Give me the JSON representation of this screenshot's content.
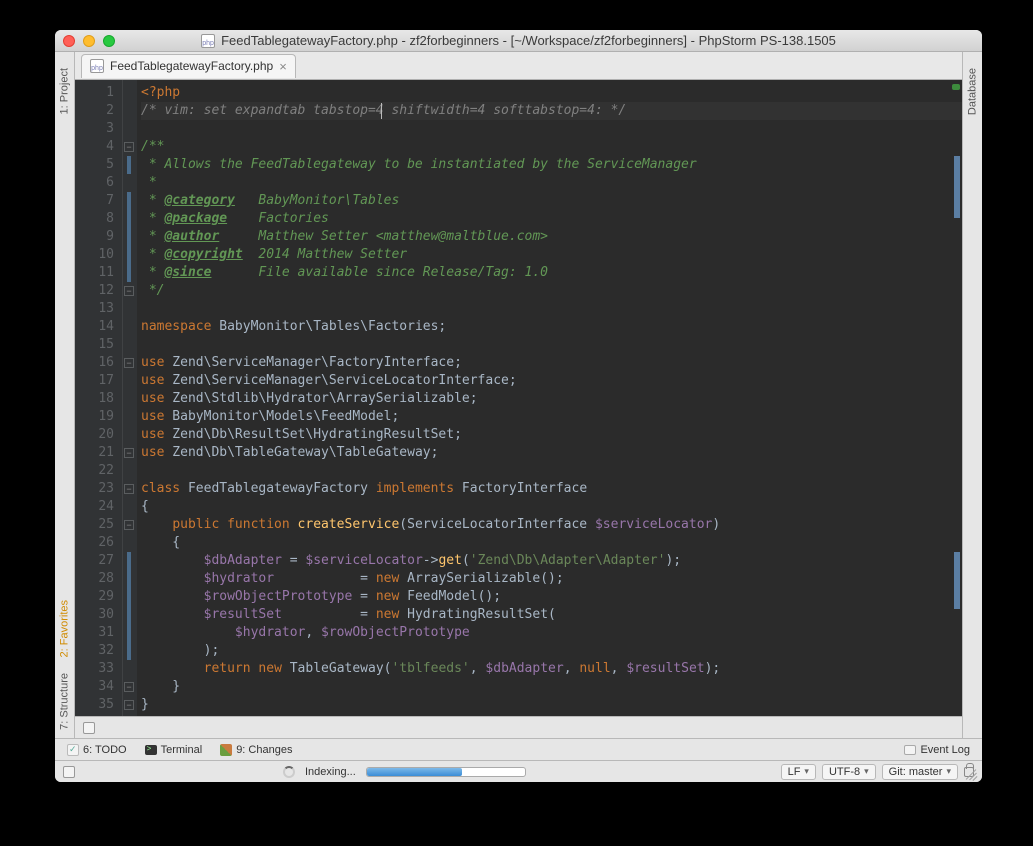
{
  "titlebar": {
    "title": "FeedTablegatewayFactory.php - zf2forbeginners - [~/Workspace/zf2forbeginners] - PhpStorm PS-138.1505"
  },
  "tabs": [
    {
      "label": "FeedTablegatewayFactory.php"
    }
  ],
  "left_rail": {
    "project": "1: Project",
    "favorites": "2: Favorites",
    "structure": "7: Structure"
  },
  "right_rail": {
    "database": "Database"
  },
  "bottom_toolbar": {
    "todo": "6: TODO",
    "terminal": "Terminal",
    "changes": "9: Changes",
    "event_log": "Event Log"
  },
  "status": {
    "indexing": "Indexing...",
    "line_ending": "LF",
    "encoding": "UTF-8",
    "git_branch": "Git: master"
  },
  "gutter": {
    "count": 35
  },
  "code_lines": [
    {
      "n": 1,
      "html": "<span class='c-tag'>&lt;?php</span>"
    },
    {
      "n": 2,
      "html": "<span class='c-comment'>/* vim: set expandtab tabstop=4 shiftwidth=4 softtabstop=4: */</span>",
      "current": true
    },
    {
      "n": 3,
      "html": ""
    },
    {
      "n": 4,
      "html": "<span class='c-doccomment'>/**</span>",
      "fold": "-"
    },
    {
      "n": 5,
      "html": "<span class='c-doccomment'> * Allows the FeedTablegateway to be instantiated by the ServiceManager</span>",
      "diff": true
    },
    {
      "n": 6,
      "html": "<span class='c-doccomment'> *</span>"
    },
    {
      "n": 7,
      "html": "<span class='c-doccomment'> * <span class='c-doctag'>@category</span>   BabyMonitor\\Tables</span>",
      "diff": true
    },
    {
      "n": 8,
      "html": "<span class='c-doccomment'> * <span class='c-doctag'>@package</span>    Factories</span>",
      "diff": true
    },
    {
      "n": 9,
      "html": "<span class='c-doccomment'> * <span class='c-doctag'>@author</span>     Matthew Setter &lt;matthew@maltblue.com&gt;</span>",
      "diff": true
    },
    {
      "n": 10,
      "html": "<span class='c-doccomment'> * <span class='c-doctag'>@copyright</span>  2014 Matthew Setter</span>",
      "diff": true
    },
    {
      "n": 11,
      "html": "<span class='c-doccomment'> * <span class='c-doctag'>@since</span>      File available since Release/Tag: 1.0</span>",
      "diff": true
    },
    {
      "n": 12,
      "html": "<span class='c-doccomment'> */</span>",
      "fold": "-"
    },
    {
      "n": 13,
      "html": ""
    },
    {
      "n": 14,
      "html": "<span class='c-keyword'>namespace</span> BabyMonitor\\Tables\\Factories;"
    },
    {
      "n": 15,
      "html": ""
    },
    {
      "n": 16,
      "html": "<span class='c-keyword'>use</span> Zend\\ServiceManager\\FactoryInterface;",
      "fold": "-"
    },
    {
      "n": 17,
      "html": "<span class='c-keyword'>use</span> Zend\\ServiceManager\\ServiceLocatorInterface;"
    },
    {
      "n": 18,
      "html": "<span class='c-keyword'>use</span> Zend\\Stdlib\\Hydrator\\ArraySerializable;"
    },
    {
      "n": 19,
      "html": "<span class='c-keyword'>use</span> BabyMonitor\\Models\\FeedModel;"
    },
    {
      "n": 20,
      "html": "<span class='c-keyword'>use</span> Zend\\Db\\ResultSet\\HydratingResultSet;"
    },
    {
      "n": 21,
      "html": "<span class='c-keyword'>use</span> Zend\\Db\\TableGateway\\TableGateway;",
      "fold": "-"
    },
    {
      "n": 22,
      "html": ""
    },
    {
      "n": 23,
      "html": "<span class='c-keyword'>class</span> FeedTablegatewayFactory <span class='c-keyword'>implements</span> FactoryInterface",
      "fold": "-"
    },
    {
      "n": 24,
      "html": "{"
    },
    {
      "n": 25,
      "html": "    <span class='c-keyword'>public function</span> <span class='c-func'>createService</span>(ServiceLocatorInterface <span class='c-var'>$serviceLocator</span>)",
      "fold": "-"
    },
    {
      "n": 26,
      "html": "    {"
    },
    {
      "n": 27,
      "html": "        <span class='c-var'>$dbAdapter</span> = <span class='c-var'>$serviceLocator</span>-&gt;<span class='c-func'>get</span>(<span class='c-string'>'Zend\\Db\\Adapter\\Adapter'</span>);",
      "diff": true
    },
    {
      "n": 28,
      "html": "        <span class='c-var'>$hydrator</span>           = <span class='c-keyword'>new</span> ArraySerializable();",
      "diff": true
    },
    {
      "n": 29,
      "html": "        <span class='c-var'>$rowObjectPrototype</span> = <span class='c-keyword'>new</span> FeedModel();",
      "diff": true
    },
    {
      "n": 30,
      "html": "        <span class='c-var'>$resultSet</span>          = <span class='c-keyword'>new</span> HydratingResultSet(",
      "diff": true
    },
    {
      "n": 31,
      "html": "            <span class='c-var'>$hydrator</span>, <span class='c-var'>$rowObjectPrototype</span>",
      "diff": true
    },
    {
      "n": 32,
      "html": "        );",
      "diff": true
    },
    {
      "n": 33,
      "html": "        <span class='c-keyword'>return new</span> TableGateway(<span class='c-string'>'tblfeeds'</span>, <span class='c-var'>$dbAdapter</span>, <span class='c-keyword'>null</span>, <span class='c-var'>$resultSet</span>);"
    },
    {
      "n": 34,
      "html": "    }",
      "fold": "-"
    },
    {
      "n": 35,
      "html": "}",
      "fold": "-"
    }
  ]
}
